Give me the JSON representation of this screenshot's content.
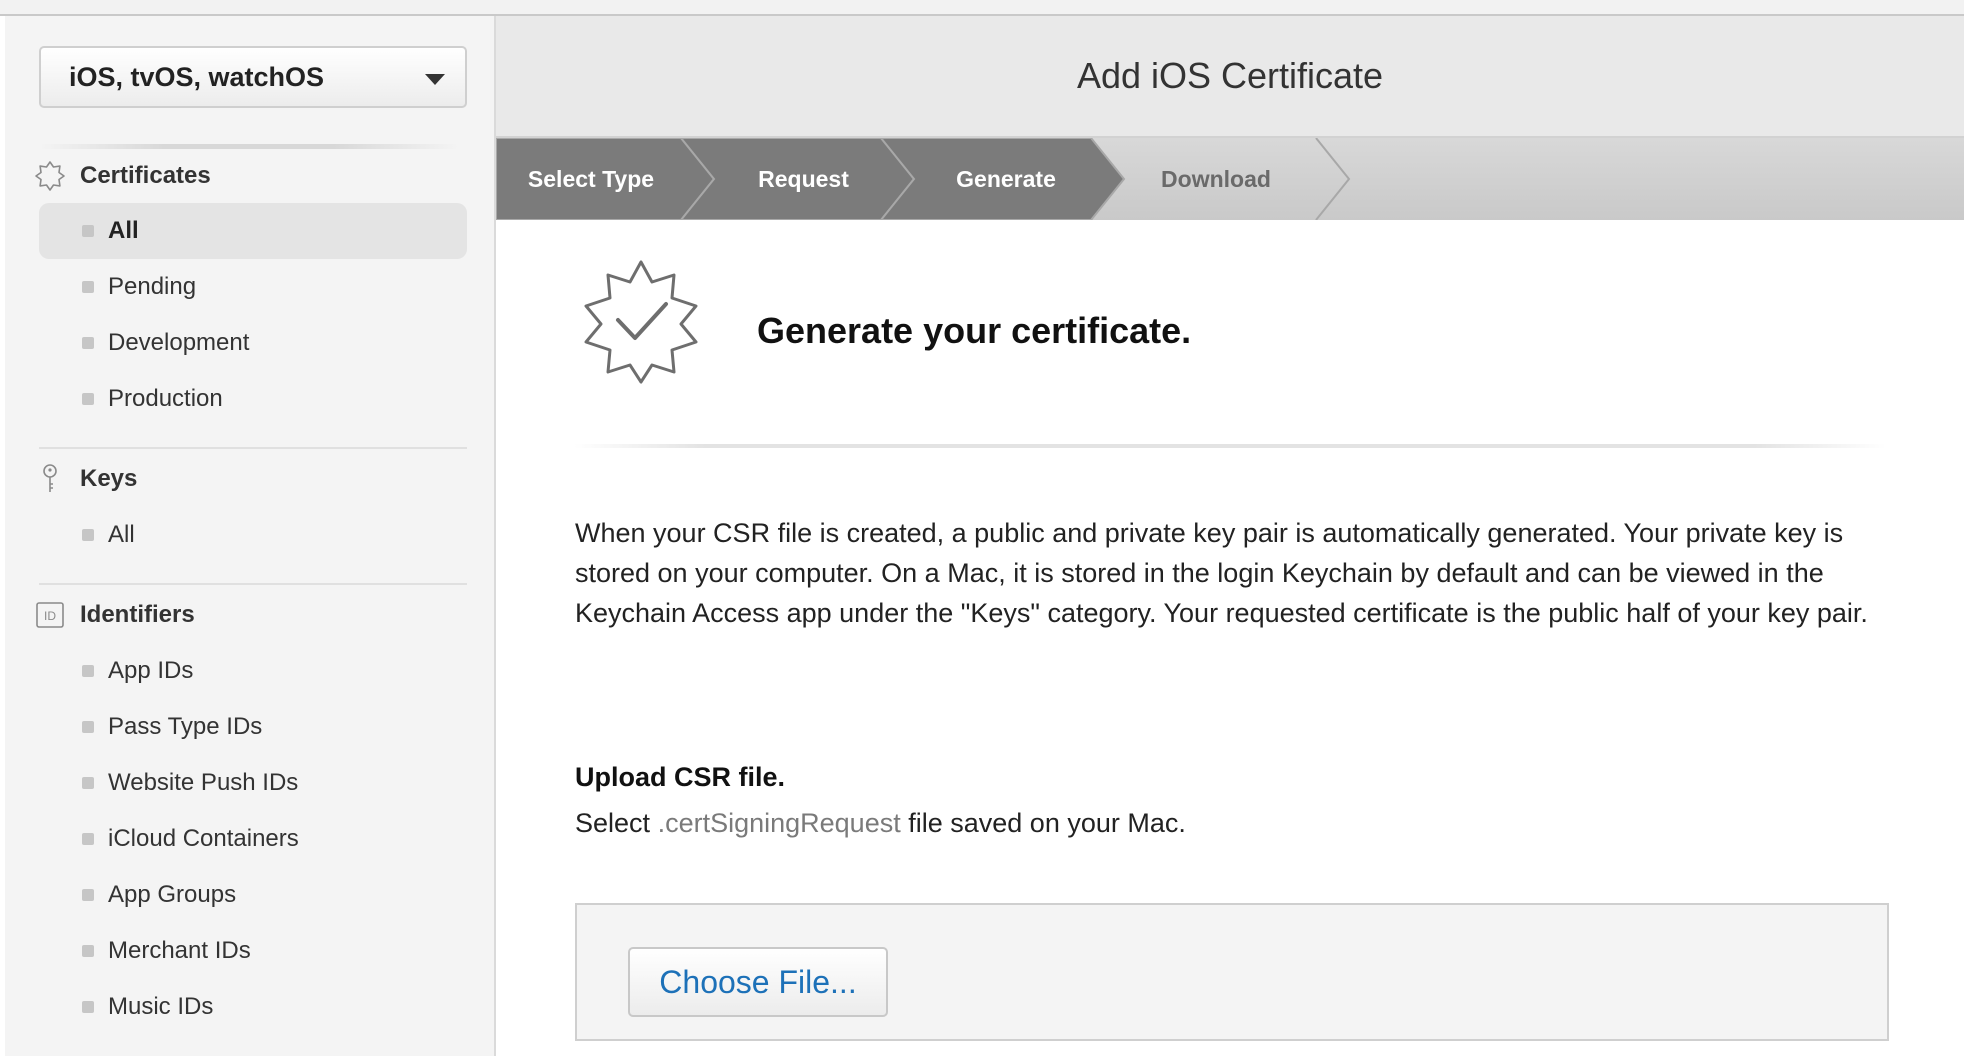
{
  "sidebar": {
    "platform_select": {
      "value": "iOS, tvOS, watchOS"
    },
    "sections": {
      "certificates": {
        "title": "Certificates",
        "icon": "certificate-badge-icon",
        "items": [
          "All",
          "Pending",
          "Development",
          "Production"
        ],
        "active": "All"
      },
      "keys": {
        "title": "Keys",
        "icon": "key-icon",
        "items": [
          "All"
        ]
      },
      "identifiers": {
        "title": "Identifiers",
        "icon": "id-icon",
        "icon_text": "ID",
        "items": [
          "App IDs",
          "Pass Type IDs",
          "Website Push IDs",
          "iCloud Containers",
          "App Groups",
          "Merchant IDs",
          "Music IDs"
        ]
      }
    }
  },
  "main": {
    "title": "Add iOS Certificate",
    "steps": [
      {
        "label": "Select Type",
        "state": "completed"
      },
      {
        "label": "Request",
        "state": "completed"
      },
      {
        "label": "Generate",
        "state": "current"
      },
      {
        "label": "Download",
        "state": "upcoming"
      }
    ],
    "content": {
      "icon": "certificate-badge-check-icon",
      "heading": "Generate your certificate.",
      "description": "When your CSR file is created, a public and private key pair is automatically generated. Your private key is stored on your computer. On a Mac, it is stored in the login Keychain by default and can be viewed in the Keychain Access app under the \"Keys\" category. Your requested certificate is the public half of your key pair.",
      "upload": {
        "title": "Upload CSR file.",
        "sub_prefix": "Select",
        "sub_ext": ".certSigningRequest",
        "sub_suffix": "file saved on your Mac.",
        "button_label": "Choose File..."
      }
    }
  },
  "colors": {
    "step_completed": "#7b7b7b",
    "step_upcoming": "#cfcfcf",
    "link_blue": "#1d71b8"
  }
}
